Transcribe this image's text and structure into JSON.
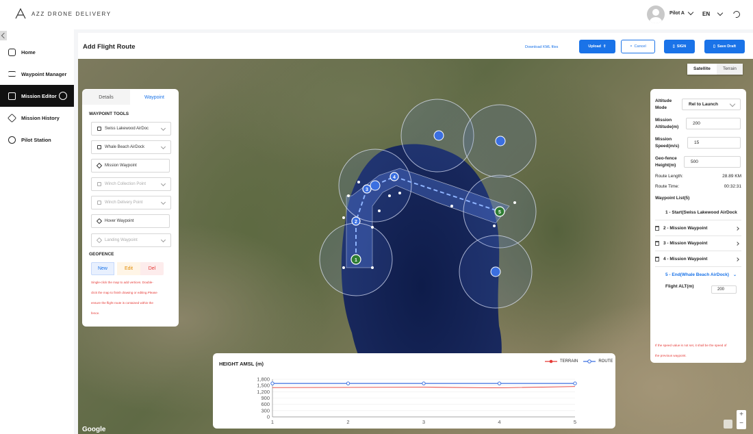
{
  "app": {
    "logo_text": "AZZ DRONE DELIVERY"
  },
  "topbar": {
    "user_label": "Pilot A",
    "language": "EN"
  },
  "sidebar": {
    "items": [
      {
        "label": "Home",
        "icon": "home-icon"
      },
      {
        "label": "Waypoint Manager",
        "icon": "list-icon"
      },
      {
        "label": "Mission Editor",
        "icon": "map-icon",
        "active": true
      },
      {
        "label": "Mission History",
        "icon": "layers-icon"
      },
      {
        "label": "Pilot Station",
        "icon": "drone-icon"
      }
    ]
  },
  "header": {
    "title": "Add Flight Route",
    "download_link": "Download KML files",
    "buttons": {
      "upload": "Upload",
      "cancel": "Cancel",
      "sign": "SIGN",
      "save_draft": "Save Draft"
    }
  },
  "map": {
    "tabs": [
      "Satellite",
      "Terrain"
    ],
    "active_tab": "Satellite",
    "attribution": "Google",
    "waypoint_markers": [
      "1",
      "2",
      "3",
      "4",
      "5"
    ],
    "colors": {
      "route": "#4a7df0",
      "zone": "#1a73e8"
    }
  },
  "left_panel": {
    "tabs": [
      "Details",
      "Waypoint"
    ],
    "active_tab": "Waypoint",
    "section_title": "WAYPOINT TOOLS",
    "tools": [
      {
        "label": "Swiss Lakewood AirDoc",
        "enabled": true,
        "dropdown": true
      },
      {
        "label": "Whale Beach AirDock",
        "enabled": true,
        "dropdown": true
      },
      {
        "label": "Mission Waypoint",
        "enabled": true,
        "dropdown": false
      },
      {
        "label": "Winch Collection Point",
        "enabled": false,
        "dropdown": true
      },
      {
        "label": "Winch Delivery Point",
        "enabled": false,
        "dropdown": true
      },
      {
        "label": "Hover Waypoint",
        "enabled": true,
        "dropdown": false
      },
      {
        "label": "Landing Waypoint",
        "enabled": false,
        "dropdown": true
      }
    ],
    "geofence_title": "GEOFENCE",
    "geofence_buttons": {
      "new": "New",
      "edit": "Edit",
      "del": "Del"
    },
    "geofence_note": [
      "Single-click the map to add vertices. Double-",
      "click the map to finish drawing or editing.Please",
      "ensure the flight route is contained within the",
      "fence."
    ]
  },
  "right_panel": {
    "altitude_mode_label": "Altitude Mode",
    "altitude_mode_value": "Rel to Launch",
    "mission_altitude_label": "Mission Altitude(m)",
    "mission_altitude_value": "200",
    "mission_speed_label": "Mission Speed(m/s)",
    "mission_speed_value": "15",
    "geofence_height_label": "Geo-fence Height(m)",
    "geofence_height_value": "500",
    "route_length_label": "Route Length:",
    "route_length_value": "28.89 KM",
    "route_time_label": "Route Time:",
    "route_time_value": "00:32:31",
    "waypoint_list_label": "Waypoint List(5)",
    "waypoints": [
      "1 - Start(Swiss Lakewood AirDock",
      "2 - Mission Waypoint",
      "3 - Mission Waypoint",
      "4 - Mission Waypoint",
      "5 - End(Whale Beach AirDock)"
    ],
    "flight_alt_label": "Flight ALT(m)",
    "flight_alt_value": "200",
    "speed_note": [
      "If the speed value is not set, it shall be the speed of",
      "the previous waypoint."
    ]
  },
  "chart_data": {
    "type": "line",
    "title": "HEIGHT AMSL (m)",
    "x": [
      1,
      2,
      3,
      4,
      5
    ],
    "xticks": [
      "1",
      "2",
      "3",
      "4",
      "5"
    ],
    "yticks": [
      "0",
      "300",
      "600",
      "900",
      "1,200",
      "1,500",
      "1,800"
    ],
    "ylim": [
      0,
      1800
    ],
    "series": [
      {
        "name": "ROUTE",
        "color": "#3b6fe0",
        "values": [
          1600,
          1600,
          1600,
          1600,
          1600
        ]
      },
      {
        "name": "TERRAIN",
        "color": "#e53935",
        "values": [
          1400,
          1410,
          1420,
          1390,
          1450
        ]
      }
    ]
  }
}
